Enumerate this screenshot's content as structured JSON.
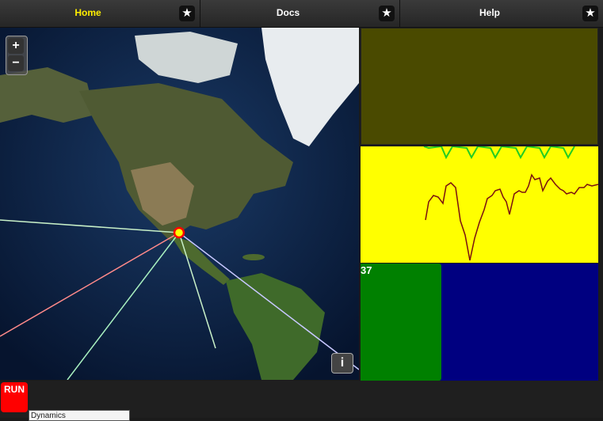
{
  "tabs": [
    {
      "label": "Home",
      "active": true
    },
    {
      "label": "Docs",
      "active": false
    },
    {
      "label": "Help",
      "active": false
    }
  ],
  "tab_star_icon": "★",
  "map": {
    "zoom_in": "+",
    "zoom_out": "−",
    "info_label": "i"
  },
  "panels": {
    "tile_count": "37"
  },
  "bottom": {
    "run_label": "RUN",
    "tree_item": "Dynamics"
  },
  "colors": {
    "active_tab": "#ffee00",
    "olive_panel": "#4a4a00",
    "chart_panel": "#ffff00",
    "navy_panel": "#000080",
    "green_tile": "#008000",
    "run_button": "#ff0000"
  }
}
